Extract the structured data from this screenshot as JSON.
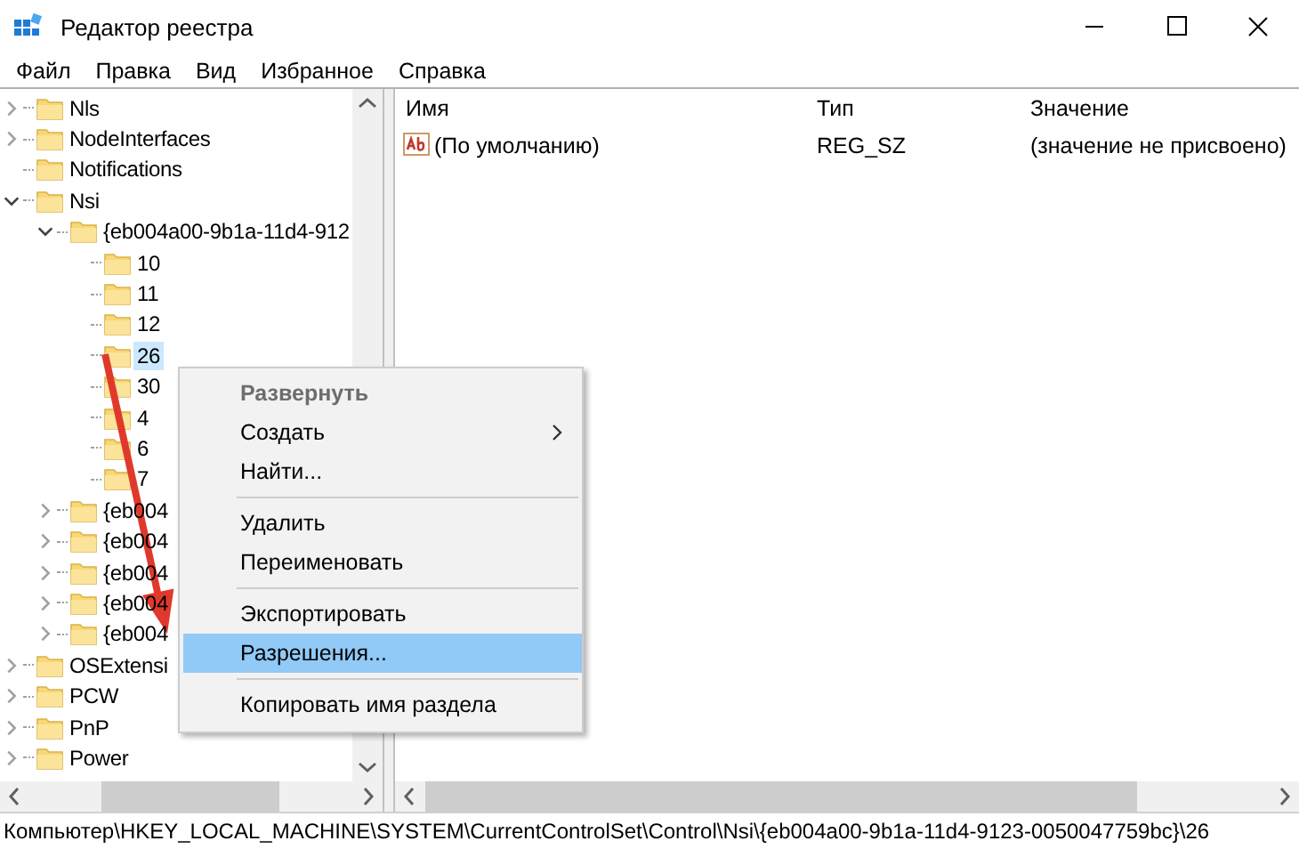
{
  "window": {
    "title": "Редактор реестра"
  },
  "menu": [
    {
      "label": "Файл"
    },
    {
      "label": "Правка"
    },
    {
      "label": "Вид"
    },
    {
      "label": "Избранное"
    },
    {
      "label": "Справка"
    }
  ],
  "tree": [
    {
      "label": "Nls",
      "expanded": false,
      "selected": false
    },
    {
      "label": "NodeInterfaces",
      "expanded": false,
      "selected": false
    },
    {
      "label": "Notifications",
      "selected": false
    },
    {
      "label": "Nsi",
      "expanded": true,
      "selected": false,
      "children": [
        {
          "label": "{eb004a00-9b1a-11d4-912",
          "expanded": true,
          "selected": false,
          "children": [
            {
              "label": "10",
              "selected": false
            },
            {
              "label": "11",
              "selected": false
            },
            {
              "label": "12",
              "selected": false
            },
            {
              "label": "26",
              "selected": true
            },
            {
              "label": "30",
              "selected": false
            },
            {
              "label": "4",
              "selected": false
            },
            {
              "label": "6",
              "selected": false
            },
            {
              "label": "7",
              "selected": false
            }
          ]
        },
        {
          "label": "{eb004",
          "expanded": false,
          "selected": false
        },
        {
          "label": "{eb004",
          "expanded": false,
          "selected": false
        },
        {
          "label": "{eb004",
          "expanded": false,
          "selected": false
        },
        {
          "label": "{eb004",
          "expanded": false,
          "selected": false
        },
        {
          "label": "{eb004",
          "expanded": false,
          "selected": false
        }
      ]
    },
    {
      "label": "OSExtensi",
      "expanded": false,
      "selected": false
    },
    {
      "label": "PCW",
      "expanded": false,
      "selected": false
    },
    {
      "label": "PnP",
      "expanded": false,
      "selected": false
    },
    {
      "label": "Power",
      "expanded": false,
      "selected": false
    }
  ],
  "values": {
    "columns": [
      "Имя",
      "Тип",
      "Значение"
    ],
    "rows": [
      {
        "name": "(По умолчанию)",
        "type": "REG_SZ",
        "data": "(значение не присвоено)"
      }
    ]
  },
  "context_menu": [
    {
      "kind": "item",
      "label": "Развернуть",
      "default": true,
      "disabled": true,
      "submenu": false,
      "selected": false
    },
    {
      "kind": "item",
      "label": "Создать",
      "default": false,
      "disabled": false,
      "submenu": true,
      "selected": false
    },
    {
      "kind": "item",
      "label": "Найти...",
      "default": false,
      "disabled": false,
      "submenu": false,
      "selected": false
    },
    {
      "kind": "separator"
    },
    {
      "kind": "item",
      "label": "Удалить",
      "default": false,
      "disabled": false,
      "submenu": false,
      "selected": false
    },
    {
      "kind": "item",
      "label": "Переименовать",
      "default": false,
      "disabled": false,
      "submenu": false,
      "selected": false
    },
    {
      "kind": "separator"
    },
    {
      "kind": "item",
      "label": "Экспортировать",
      "default": false,
      "disabled": false,
      "submenu": false,
      "selected": false
    },
    {
      "kind": "item",
      "label": "Разрешения...",
      "default": false,
      "disabled": false,
      "submenu": false,
      "selected": true
    },
    {
      "kind": "separator"
    },
    {
      "kind": "item",
      "label": "Копировать имя раздела",
      "default": false,
      "disabled": false,
      "submenu": false,
      "selected": false
    }
  ],
  "status_bar": "Компьютер\\HKEY_LOCAL_MACHINE\\SYSTEM\\CurrentControlSet\\Control\\Nsi\\{eb004a00-9b1a-11d4-9123-0050047759bc}\\26"
}
